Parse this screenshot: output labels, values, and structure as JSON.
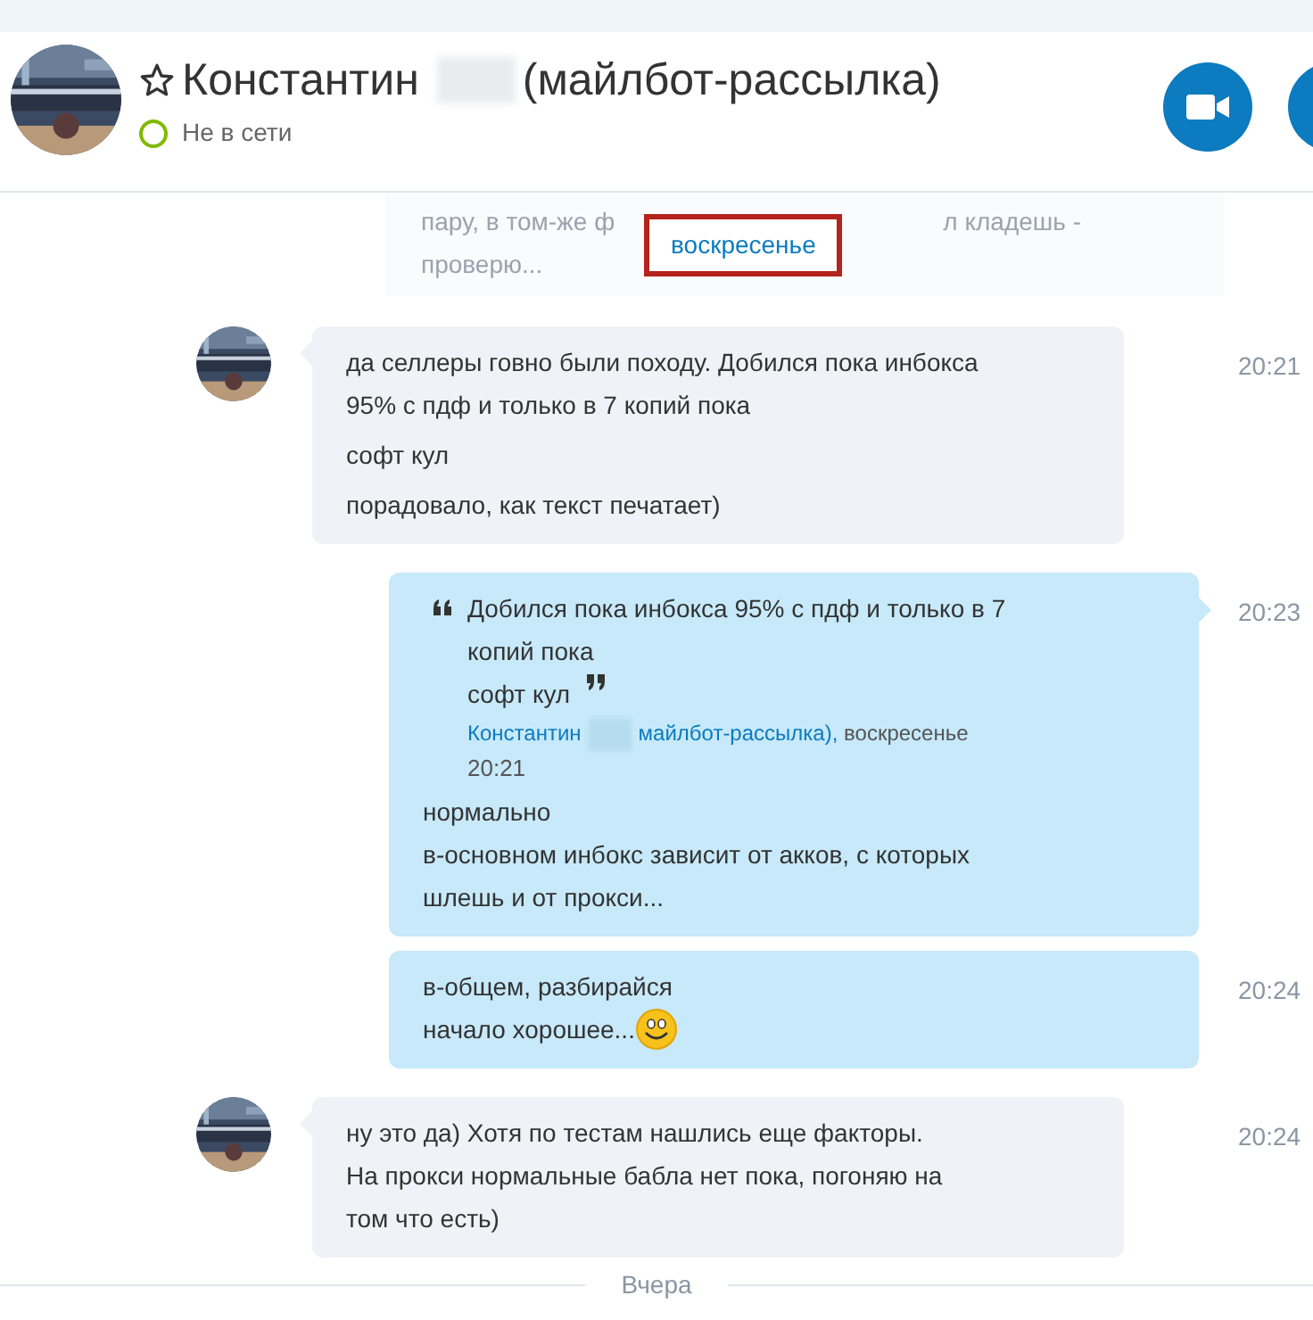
{
  "header": {
    "name_first": "Константин",
    "name_rest": "(майлбот-рассылка)",
    "favorite": false,
    "status": "Не в сети",
    "online": false
  },
  "faded_message": {
    "line_1_left": "пару, в том-же ф",
    "line_1_right": "л кладешь -",
    "line_2": "проверю..."
  },
  "day_divider": {
    "label": "воскресенье",
    "highlighted": true
  },
  "messages": [
    {
      "kind": "incoming",
      "avatar": true,
      "time": "20:21",
      "paragraphs": [
        [
          "да селлеры говно были походу. Добился пока инбокса",
          "95% с пдф и только в 7 копий пока"
        ],
        [
          "софт кул"
        ],
        [
          "порадовало, как текст печатает)"
        ]
      ]
    },
    {
      "kind": "outgoing",
      "tail": true,
      "time": "20:23",
      "quote": {
        "lines": [
          "Добился пока инбокса 95% с пдф и только в 7",
          "копий пока",
          "софт кул"
        ],
        "author_first": "Константин",
        "author_rest": "майлбот-рассылка),",
        "date": "воскресенье",
        "time": "20:21"
      },
      "paragraphs": [
        [
          "нормально",
          "в-основном инбокс зависит от акков, с которых",
          "шлешь и от прокси..."
        ]
      ]
    },
    {
      "kind": "outgoing",
      "tail": false,
      "time": "20:24",
      "paragraphs": [
        [
          "в-общем, разбирайся",
          "начало хорошее..."
        ]
      ],
      "emoji": true
    },
    {
      "kind": "incoming",
      "avatar": true,
      "time": "20:24",
      "paragraphs": [
        [
          "ну это да) Хотя по тестам нашлись еще факторы.",
          "На прокси нормальные бабла нет пока, погоняю на",
          "том что есть)"
        ]
      ]
    }
  ],
  "bottom_divider": {
    "label": "Вчера"
  }
}
